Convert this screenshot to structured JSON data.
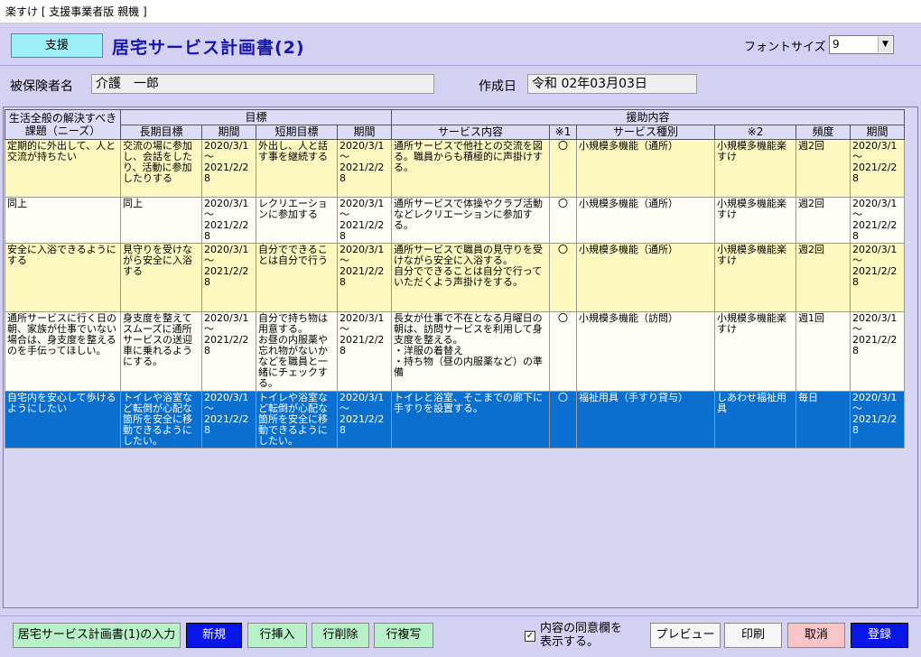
{
  "window": {
    "title": "楽すけ [ 支援事業者版 親機 ]"
  },
  "header": {
    "badge": "支援",
    "title": "居宅サービス計画書(2)",
    "font_size_label": "フォントサイズ",
    "font_size_value": "9"
  },
  "info": {
    "insured_label": "被保険者名",
    "insured_value": "介護　一郎",
    "created_label": "作成日",
    "created_value": "令和 02年03月03日"
  },
  "grid": {
    "group_headers": {
      "needs": "生活全般の解決すべき課題（ニーズ）",
      "goals": "目標",
      "support": "援助内容"
    },
    "sub_headers": {
      "long_goal": "長期目標",
      "long_period": "期間",
      "short_goal": "短期目標",
      "short_period": "期間",
      "service": "サービス内容",
      "note1": "※1",
      "service_type": "サービス種別",
      "note2": "※2",
      "frequency": "頻度",
      "period": "期間"
    },
    "rows": [
      {
        "needs": "定期的に外出して、人と交流が持ちたい",
        "long_goal": "交流の場に参加し、会話をしたり、活動に参加したりする",
        "long_period": "2020/3/1\n～\n2021/2/28",
        "short_goal": "外出し、人と話す事を継続する",
        "short_period": "2020/3/1\n～\n2021/2/28",
        "service": "通所サービスで他社との交流を図る。職員からも積極的に声掛けする。",
        "note1": "〇",
        "service_type": "小規模多機能（通所）",
        "note2": "小規模多機能楽すけ",
        "frequency": "週2回",
        "period": "2020/3/1\n～\n2021/2/28"
      },
      {
        "needs": "同上",
        "long_goal": "同上",
        "long_period": "2020/3/1\n～\n2021/2/28",
        "short_goal": "レクリエーションに参加する",
        "short_period": "2020/3/1\n～\n2021/2/28",
        "service": "通所サービスで体操やクラブ活動などレクリエーションに参加する。",
        "note1": "〇",
        "service_type": "小規模多機能（通所）",
        "note2": "小規模多機能楽すけ",
        "frequency": "週2回",
        "period": "2020/3/1\n～\n2021/2/28"
      },
      {
        "needs": "安全に入浴できるようにする",
        "long_goal": "見守りを受けながら安全に入浴する",
        "long_period": "2020/3/1\n～\n2021/2/28",
        "short_goal": "自分でできることは自分で行う",
        "short_period": "2020/3/1\n～\n2021/2/28",
        "service": "通所サービスで職員の見守りを受けながら安全に入浴する。\n自分でできることは自分で行っていただくよう声掛けをする。",
        "note1": "〇",
        "service_type": "小規模多機能（通所）",
        "note2": "小規模多機能楽すけ",
        "frequency": "週2回",
        "period": "2020/3/1\n～\n2021/2/28"
      },
      {
        "needs": "通所サービスに行く日の朝、家族が仕事でいない場合は、身支度を整えるのを手伝ってほしい。",
        "long_goal": "身支度を整えてスムーズに通所サービスの送迎車に乗れるようにする。",
        "long_period": "2020/3/1\n～\n2021/2/28",
        "short_goal": "自分で持ち物は用意する。\nお昼の内服薬や忘れ物がないかなどを職員と一緒にチェックする。",
        "short_period": "2020/3/1\n～\n2021/2/28",
        "service": "長女が仕事で不在となる月曜日の朝は、訪問サービスを利用して身支度を整える。\n・洋服の着替え\n・持ち物（昼の内服薬など）の準備",
        "note1": "〇",
        "service_type": "小規模多機能（訪問）",
        "note2": "小規模多機能楽すけ",
        "frequency": "週1回",
        "period": "2020/3/1\n～\n2021/2/28"
      },
      {
        "needs": "自宅内を安心して歩けるようにしたい",
        "long_goal": "トイレや浴室など転倒が心配な箇所を安全に移動できるようにしたい。",
        "long_period": "2020/3/1\n～\n2021/2/28",
        "short_goal": "トイレや浴室など転倒が心配な箇所を安全に移動できるようにしたい。",
        "short_period": "2020/3/1\n～\n2021/2/28",
        "service": "トイレと浴室、そこまでの廊下に手すりを設置する。",
        "note1": "〇",
        "service_type": "福祉用具（手すり貸与）",
        "note2": "しあわせ福祉用具",
        "frequency": "毎日",
        "period": "2020/3/1\n～\n2021/2/28"
      }
    ]
  },
  "footer": {
    "input_plan1": "居宅サービス計画書(1)の入力",
    "new": "新規",
    "insert_row": "行挿入",
    "delete_row": "行削除",
    "copy_row": "行複写",
    "consent_checked": "✓",
    "consent_label_line1": "内容の同意欄を",
    "consent_label_line2": "表示する。",
    "preview": "プレビュー",
    "print": "印刷",
    "cancel": "取消",
    "register": "登録"
  }
}
